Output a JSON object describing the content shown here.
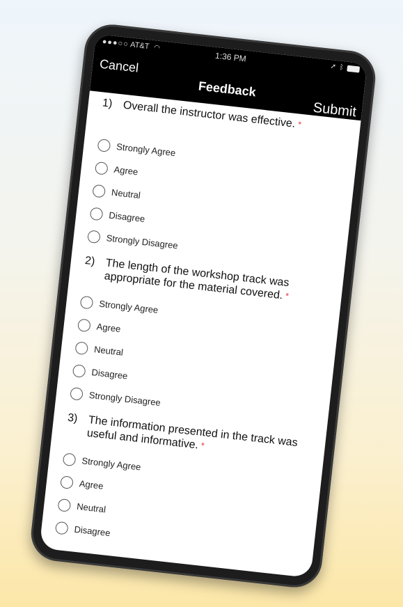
{
  "status_bar": {
    "carrier": "AT&T",
    "time": "1:36 PM"
  },
  "nav": {
    "cancel": "Cancel",
    "title": "Feedback",
    "submit": "Submit"
  },
  "questions": [
    {
      "number": "1)",
      "text": "Overall the instructor was effective.",
      "required_marker": "*",
      "options": [
        "Strongly Agree",
        "Agree",
        "Neutral",
        "Disagree",
        "Strongly Disagree"
      ]
    },
    {
      "number": "2)",
      "text": "The length of the workshop track was appropriate for the material covered.",
      "required_marker": "*",
      "options": [
        "Strongly Agree",
        "Agree",
        "Neutral",
        "Disagree",
        "Strongly Disagree"
      ]
    },
    {
      "number": "3)",
      "text": "The information presented in the track was useful and informative.",
      "required_marker": "*",
      "options": [
        "Strongly Agree",
        "Agree",
        "Neutral",
        "Disagree"
      ]
    }
  ]
}
